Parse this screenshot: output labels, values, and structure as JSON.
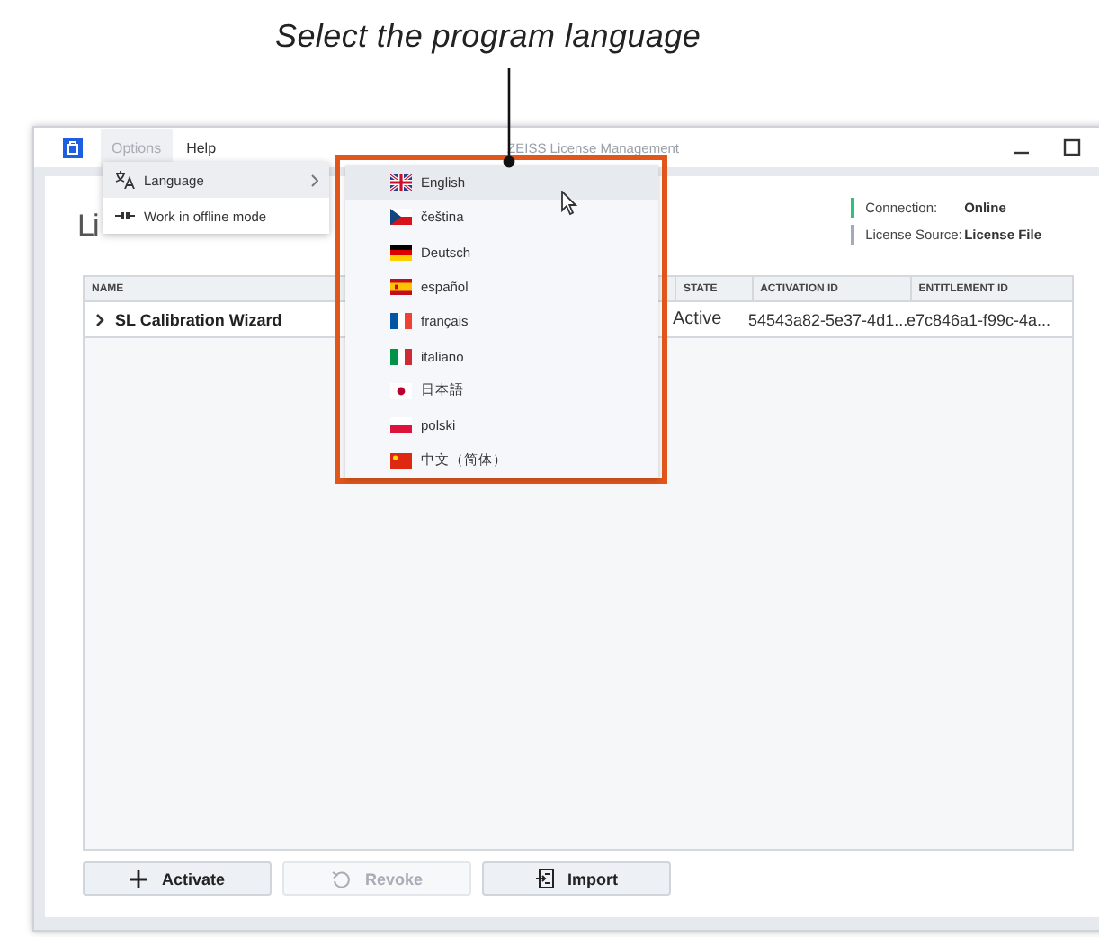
{
  "caption": "Select the program language",
  "window": {
    "title": "ZEISS License Management"
  },
  "menu_bar": [
    {
      "label": "Options",
      "selected": true
    },
    {
      "label": "Help",
      "selected": false
    }
  ],
  "options_menu": [
    {
      "kind": "language",
      "label": "Language",
      "selected": true
    },
    {
      "kind": "offline",
      "label": "Work in offline mode",
      "selected": false
    }
  ],
  "language_menu": [
    {
      "kind": "gb",
      "label": "English",
      "selected": true
    },
    {
      "kind": "cz",
      "label": "čeština",
      "selected": false
    },
    {
      "kind": "de",
      "label": "Deutsch",
      "selected": false
    },
    {
      "kind": "es",
      "label": "español",
      "selected": false
    },
    {
      "kind": "fr",
      "label": "français",
      "selected": false
    },
    {
      "kind": "it",
      "label": "italiano",
      "selected": false
    },
    {
      "kind": "jp",
      "label": "日本語",
      "selected": false
    },
    {
      "kind": "pl",
      "label": "polski",
      "selected": false
    },
    {
      "kind": "cn",
      "label": "中文（简体）",
      "selected": false
    }
  ],
  "page": {
    "heading": "Li"
  },
  "status": [
    {
      "label": "Connection:",
      "value": "Online",
      "color": "#2ec27e"
    },
    {
      "label": "License Source:",
      "value": "License File",
      "color": "#a3aab8"
    }
  ],
  "table": {
    "columns": [
      "NAME",
      "STATE",
      "ACTIVATION ID",
      "ENTITLEMENT ID"
    ],
    "rows": [
      {
        "expanded": false,
        "cells": [
          "SL Calibration Wizard",
          "Active",
          "54543a82-5e37-4d1...",
          "e7c846a1-f99c-4a..."
        ]
      }
    ]
  },
  "buttons": [
    {
      "kind": "activate",
      "label": "Activate",
      "disabled": false
    },
    {
      "kind": "revoke",
      "label": "Revoke",
      "disabled": true
    },
    {
      "kind": "import",
      "label": "Import",
      "disabled": false
    }
  ]
}
